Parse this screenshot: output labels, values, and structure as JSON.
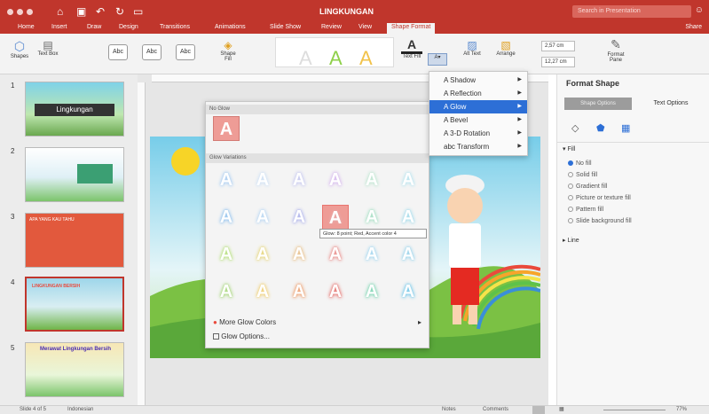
{
  "app": {
    "doc_title": "LINGKUNGAN",
    "search_placeholder": "Search in Presentation",
    "share": "Share"
  },
  "tabs": [
    "Home",
    "Insert",
    "Draw",
    "Design",
    "Transitions",
    "Animations",
    "Slide Show",
    "Review",
    "View",
    "Shape Format"
  ],
  "ribbon": {
    "shapes": "Shapes",
    "text_box": "Text Box",
    "shape_fill": "Shape Fill",
    "text_fill": "Text Fill",
    "alt_text": "Alt Text",
    "arrange": "Arrange",
    "format_pane": "Format Pane",
    "height": "2,57 cm",
    "width": "12,27 cm",
    "abc": [
      "Abc",
      "Abc",
      "Abc"
    ],
    "bigA": "A"
  },
  "text_effects_menu": {
    "items": [
      {
        "label": "Shadow",
        "icon": "shadow-icon"
      },
      {
        "label": "Reflection",
        "icon": "reflection-icon"
      },
      {
        "label": "Glow",
        "icon": "glow-icon"
      },
      {
        "label": "Bevel",
        "icon": "bevel-icon"
      },
      {
        "label": "3-D Rotation",
        "icon": "rotation-icon"
      },
      {
        "label": "Transform",
        "icon": "transform-icon"
      }
    ],
    "active": "Glow"
  },
  "glow_menu": {
    "no_glow": "No Glow",
    "variations": "Glow Variations",
    "more_colors": "More Glow Colors",
    "options": "Glow Options...",
    "letter": "A",
    "rows": [
      [
        "#a9cdf2",
        "#cfe1f5",
        "#c7c9f0",
        "#d7b9ee",
        "#bfe6d2",
        "#b9e4ef"
      ],
      [
        "#94c4ef",
        "#b9d7f3",
        "#aeb3ec",
        "#e8aaa9",
        "#a7e0c5",
        "#a5dcec"
      ],
      [
        "#b7e07e",
        "#e7d77e",
        "#e9c08a",
        "#ea8e8b",
        "#a6d8f0",
        "#9ad4ec"
      ],
      [
        "#a8d77b",
        "#f0d074",
        "#ee9f6e",
        "#e6736f",
        "#7fd6b4",
        "#74c8ea"
      ]
    ],
    "colors": {
      "accent": "#e9756f",
      "selected_bg": "#ee9c96"
    }
  },
  "tooltip": "Glow: 8 point; Red, Accent color 4",
  "format_pane": {
    "title": "Format Shape",
    "tab_shape": "Shape Options",
    "tab_text": "Text Options",
    "fill_section": "Fill",
    "fill_options": [
      "No fill",
      "Solid fill",
      "Gradient fill",
      "Picture or texture fill",
      "Pattern fill",
      "Slide background fill"
    ],
    "line_section": "Line"
  },
  "thumbnails": [
    {
      "num": "1",
      "title": "Lingkungan"
    },
    {
      "num": "2",
      "title": ""
    },
    {
      "num": "3",
      "title": "APA YANG KAU TAHU"
    },
    {
      "num": "4",
      "title": "LINGKUNGAN BERSIH"
    },
    {
      "num": "5",
      "title": "Merawat Lingkungan Bersih"
    }
  ],
  "status": {
    "slide": "Slide 4 of 5",
    "language": "Indonesian",
    "notes": "Notes",
    "comments": "Comments",
    "zoom": "77%"
  },
  "colors": {
    "brand": "#c0362c",
    "accent": "#2d6fd6"
  }
}
